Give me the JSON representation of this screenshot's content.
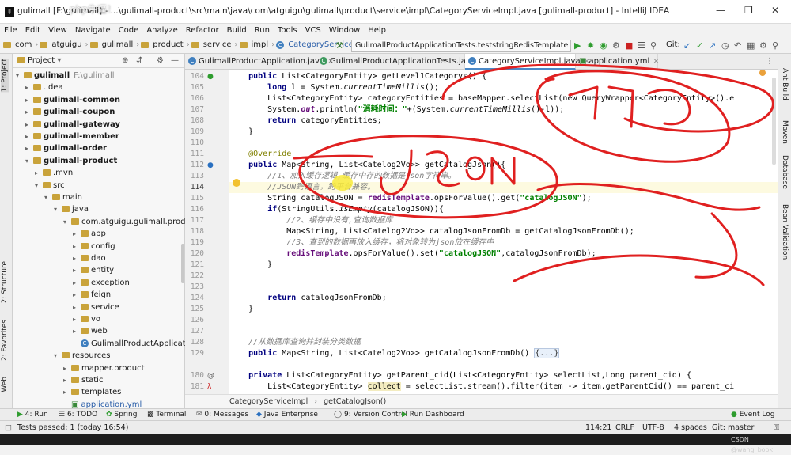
{
  "titlebar": {
    "title": "gulimall [F:\\gulimall] - ...\\gulimall-product\\src\\main\\java\\com\\atguigu\\gulimall\\product\\service\\impl\\CategoryServiceImpl.java [gulimall-product] - IntelliJ IDEA",
    "watermark": "php牛逼！"
  },
  "menu": [
    "File",
    "Edit",
    "View",
    "Navigate",
    "Code",
    "Analyze",
    "Refactor",
    "Build",
    "Run",
    "Tools",
    "VCS",
    "Window",
    "Help"
  ],
  "breadcrumb": [
    "com",
    "atguigu",
    "gulimall",
    "product",
    "service",
    "impl",
    "CategoryServiceImpl"
  ],
  "run_config": "GulimallProductApplicationTests.teststringRedisTemplate",
  "git_label": "Git:",
  "left_tool_tabs": [
    "1: Project",
    "2: Structure",
    "2: Favorites",
    "Web"
  ],
  "right_tool_tabs": [
    "Ant Build",
    "Maven",
    "Database",
    "Bean Validation"
  ],
  "project": {
    "header": "Project",
    "tree": [
      {
        "label": "gulimall",
        "suffix": "F:\\gulimall",
        "depth": 0,
        "open": true,
        "bold": true
      },
      {
        "label": ".idea",
        "depth": 1,
        "open": false
      },
      {
        "label": "gulimall-common",
        "depth": 1,
        "open": false,
        "bold": true
      },
      {
        "label": "gulimall-coupon",
        "depth": 1,
        "open": false,
        "bold": true
      },
      {
        "label": "gulimall-gateway",
        "depth": 1,
        "open": false,
        "bold": true
      },
      {
        "label": "gulimall-member",
        "depth": 1,
        "open": false,
        "bold": true
      },
      {
        "label": "gulimall-order",
        "depth": 1,
        "open": false,
        "bold": true
      },
      {
        "label": "gulimall-product",
        "depth": 1,
        "open": true,
        "bold": true
      },
      {
        "label": ".mvn",
        "depth": 2,
        "open": false
      },
      {
        "label": "src",
        "depth": 2,
        "open": true
      },
      {
        "label": "main",
        "depth": 3,
        "open": true
      },
      {
        "label": "java",
        "depth": 4,
        "open": true
      },
      {
        "label": "com.atguigu.gulimall.produ",
        "depth": 5,
        "open": true
      },
      {
        "label": "app",
        "depth": 6,
        "open": false
      },
      {
        "label": "config",
        "depth": 6,
        "open": false
      },
      {
        "label": "dao",
        "depth": 6,
        "open": false
      },
      {
        "label": "entity",
        "depth": 6,
        "open": false
      },
      {
        "label": "exception",
        "depth": 6,
        "open": false
      },
      {
        "label": "feign",
        "depth": 6,
        "open": false
      },
      {
        "label": "service",
        "depth": 6,
        "open": false
      },
      {
        "label": "vo",
        "depth": 6,
        "open": false
      },
      {
        "label": "web",
        "depth": 6,
        "open": false
      },
      {
        "label": "GulimallProductApplicat",
        "depth": 6,
        "kind": "class"
      },
      {
        "label": "resources",
        "depth": 4,
        "open": true
      },
      {
        "label": "mapper.product",
        "depth": 5,
        "open": false
      },
      {
        "label": "static",
        "depth": 5,
        "open": false
      },
      {
        "label": "templates",
        "depth": 5,
        "open": false
      },
      {
        "label": "application.yml",
        "depth": 5,
        "kind": "yml"
      }
    ]
  },
  "tabs": [
    {
      "label": "GulimallProductApplication.java",
      "active": false
    },
    {
      "label": "GulimallProductApplicationTests.java",
      "active": false
    },
    {
      "label": "CategoryServiceImpl.java",
      "active": true
    },
    {
      "label": "application.yml",
      "active": false
    }
  ],
  "editor": {
    "line_numbers": [
      "104",
      "105",
      "106",
      "107",
      "108",
      "109",
      "110",
      "111",
      "112",
      "113",
      "114",
      "115",
      "116",
      "117",
      "118",
      "119",
      "120",
      "121",
      "122",
      "123",
      "124",
      "125",
      "126",
      "127",
      "128",
      "129",
      "180",
      "181"
    ],
    "current_line": "114",
    "code": {
      "l104_a": "    public ",
      "l104_b": "List<CategoryEntity> getLevel1Categorys() {",
      "l105_a": "        ",
      "l105_b": "long",
      "l105_c": " l = System.",
      "l105_d": "currentTimeMillis",
      "l105_e": "();",
      "l106_a": "        List<CategoryEntity> categoryEntities = baseMapper.selectList(new QueryWrapper<CategoryEntity>().e",
      "l107_a": "        System.",
      "l107_b": "out",
      "l107_c": ".println(",
      "l107_d": "\"消耗时间：\"",
      "l107_e": "+(System.",
      "l107_f": "currentTimeMillis",
      "l107_g": "()-l));",
      "l108_a": "        ",
      "l108_b": "return",
      "l108_c": " categoryEntities;",
      "l109_a": "    }",
      "l111_a": "    @Override",
      "l112_a": "    ",
      "l112_b": "public",
      "l112_c": " Map<String, List<Catelog2Vo>> getCatalogJson(){",
      "l113_a": "        //1、加入缓存逻辑,缓存中存的数据是json字符串。",
      "l114_a": "        //JSON跨语言，跨平台兼容。",
      "l115_a": "        String catalogJSON = ",
      "l115_b": "redisTemplate",
      "l115_c": ".opsForValue().get(",
      "l115_d": "\"catalogJSON\"",
      "l115_e": ");",
      "l116_a": "        ",
      "l116_b": "if",
      "l116_c": "(StringUtils.",
      "l116_d": "isEmpty",
      "l116_e": "(catalogJSON)){",
      "l117_a": "            //2、缓存中没有,查询数据库",
      "l118_a": "            Map<String, List<Catelog2Vo>> catalogJsonFromDb = getCatalogJsonFromDb();",
      "l119_a": "            //3、查到的数据再放入缓存，将对象转为json放在缓存中",
      "l120_a": "            ",
      "l120_b": "redisTemplate",
      "l120_c": ".opsForValue().set(",
      "l120_d": "\"catalogJSON\"",
      "l120_e": ",catalogJsonFromDb);",
      "l121_a": "        }",
      "l124_a": "        ",
      "l124_b": "return",
      "l124_c": " catalogJsonFromDb;",
      "l125_a": "    }",
      "l128_a": "    //从数据库查询并封装分类数据",
      "l129_a": "    ",
      "l129_b": "public",
      "l129_c": " Map<String, List<Catelog2Vo>> getCatalogJsonFromDb() ",
      "l129_d": "{...}",
      "l180_a": "    ",
      "l180_b": "private",
      "l180_c": " List<CategoryEntity> getParent_cid(List<CategoryEntity> selectList,Long parent_cid) {",
      "l181_a": "        List<CategoryEntity> ",
      "l181_b": "collect",
      "l181_c": " = selectList.stream().filter(item -> item.getParentCid() == parent_ci"
    },
    "breadcrumbs": [
      "CategoryServiceImpl",
      "getCatalogJson()"
    ]
  },
  "tool_windows": [
    "4: Run",
    "6: TODO",
    "Spring",
    "Terminal",
    "0: Messages",
    "Java Enterprise",
    "9: Version Control",
    "Run Dashboard",
    "Event Log"
  ],
  "status": {
    "message": "Tests passed: 1 (today 16:54)",
    "position": "114:21",
    "line_sep": "CRLF",
    "encoding": "UTF-8",
    "indent": "4 spaces",
    "vcs": "Git: master",
    "credit": "CSDN @wang_book"
  },
  "colors": {
    "accent": "#4a88c7",
    "annotation_stroke": "#e02020",
    "highlight": "#f8ea3a"
  }
}
